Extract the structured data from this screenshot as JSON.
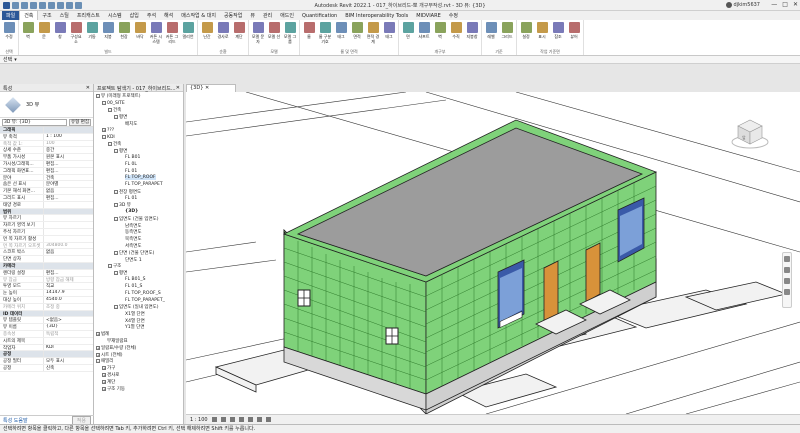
{
  "title": "Autodesk Revit 2022.1 - 017_하이브리드-뽀 개구부작성.rvt - 3D 뷰: {3D}",
  "user": "djkim5637",
  "ribbon_tabs": [
    "파일",
    "건축",
    "구조",
    "스틸",
    "프리캐스트",
    "시스템",
    "삽입",
    "주석",
    "해석",
    "매스작업 & 대지",
    "공동작업",
    "뷰",
    "관리",
    "애드인",
    "Quantification",
    "BIM Interoperability Tools",
    "MIDVIARE",
    "수정"
  ],
  "ribbon_groups": [
    {
      "label": "선택",
      "buttons": [
        "수정"
      ]
    },
    {
      "label": "빌드",
      "buttons": [
        "벽",
        "문",
        "창",
        "구성요소",
        "기둥",
        "지붕",
        "천장",
        "바닥",
        "커튼 시스템",
        "커튼 그리드",
        "멀리언"
      ]
    },
    {
      "label": "순환",
      "buttons": [
        "난간",
        "경사로",
        "계단"
      ]
    },
    {
      "label": "모델",
      "buttons": [
        "모델 문자",
        "모델 선",
        "모델 그룹"
      ]
    },
    {
      "label": "룸 및 면적",
      "buttons": [
        "룸",
        "룸 구분 기호",
        "태그",
        "면적",
        "면적 경계",
        "태그"
      ]
    },
    {
      "label": "개구부",
      "buttons": [
        "면",
        "샤프트",
        "벽",
        "수직",
        "지붕창"
      ]
    },
    {
      "label": "기준",
      "buttons": [
        "레벨",
        "그리드"
      ]
    },
    {
      "label": "작업 기준면",
      "buttons": [
        "설정",
        "표시",
        "참조",
        "뷰어"
      ]
    }
  ],
  "options_bar": {
    "select_label": "선택",
    "build_label": "빌드"
  },
  "properties": {
    "header": "특성",
    "type_name": "3D 뷰",
    "selector": "3D 뷰: {3D}",
    "edit_type": "유형 편집",
    "rows": [
      {
        "k": "그래픽",
        "v": "",
        "grp": true
      },
      {
        "k": "뷰 축척",
        "v": "1 : 100"
      },
      {
        "k": "축척 값 1:",
        "v": "100",
        "dim": true
      },
      {
        "k": "상세 수준",
        "v": "중간"
      },
      {
        "k": "부품 가시성",
        "v": "원본 표시"
      },
      {
        "k": "가시성/그래픽...",
        "v": "편집..."
      },
      {
        "k": "그래픽 화면표...",
        "v": "편집..."
      },
      {
        "k": "분야",
        "v": "건축"
      },
      {
        "k": "숨은 선 표시",
        "v": "분야별"
      },
      {
        "k": "기본 해석 화면...",
        "v": "없음"
      },
      {
        "k": "그리드 표시",
        "v": "편집..."
      },
      {
        "k": "태양 경로",
        "v": ""
      },
      {
        "k": "범위",
        "v": "",
        "grp": true
      },
      {
        "k": "뷰 자르기",
        "v": ""
      },
      {
        "k": "자르기 영역 보기",
        "v": ""
      },
      {
        "k": "주석 자르기",
        "v": ""
      },
      {
        "k": "먼 쪽 자르기 활성",
        "v": ""
      },
      {
        "k": "먼 쪽 자르기 오프셋",
        "v": "304800.0",
        "dim": true
      },
      {
        "k": "스코프 박스",
        "v": "없음"
      },
      {
        "k": "단면 상자",
        "v": ""
      },
      {
        "k": "카메라",
        "v": "",
        "grp": true
      },
      {
        "k": "렌더링 설정",
        "v": "편집..."
      },
      {
        "k": "뷰 잠금",
        "v": "방향 잠금 해제",
        "dim": true
      },
      {
        "k": "투영 모드",
        "v": "직교"
      },
      {
        "k": "눈 높이",
        "v": "14147.9"
      },
      {
        "k": "대상 높이",
        "v": "4540.0"
      },
      {
        "k": "카메라 위치",
        "v": "조정 중",
        "dim": true
      },
      {
        "k": "ID 데이터",
        "v": "",
        "grp": true
      },
      {
        "k": "뷰 템플릿",
        "v": "<없음>"
      },
      {
        "k": "뷰 이름",
        "v": "{3D}"
      },
      {
        "k": "종속성",
        "v": "독립적",
        "dim": true
      },
      {
        "k": "시트의 제목",
        "v": ""
      },
      {
        "k": "작업자",
        "v": "KDI"
      },
      {
        "k": "공정",
        "v": "",
        "grp": true
      },
      {
        "k": "공정 필터",
        "v": "모두 표시"
      },
      {
        "k": "공정",
        "v": "신축"
      }
    ],
    "help_link": "특성 도움말",
    "apply": "적용"
  },
  "browser": {
    "header": "프로젝트 탐색기 - 017_하이브리드...",
    "items": [
      {
        "t": "뷰 (미래형 프로젝트)",
        "d": 0,
        "tg": "-"
      },
      {
        "t": "00_SITE",
        "d": 1,
        "tg": "-"
      },
      {
        "t": "건축",
        "d": 2,
        "tg": "-"
      },
      {
        "t": "평면",
        "d": 3,
        "tg": "-"
      },
      {
        "t": "배치도",
        "d": 4
      },
      {
        "t": "???",
        "d": 1,
        "tg": "+"
      },
      {
        "t": "KDI",
        "d": 1,
        "tg": "-"
      },
      {
        "t": "건축",
        "d": 2,
        "tg": "-"
      },
      {
        "t": "평면",
        "d": 3,
        "tg": "-"
      },
      {
        "t": "FL B01",
        "d": 4
      },
      {
        "t": "FL 0L",
        "d": 4
      },
      {
        "t": "FL 01",
        "d": 4
      },
      {
        "t": "FL TOP_ROOF",
        "d": 4,
        "sel": true
      },
      {
        "t": "FL TOP_PARAPET",
        "d": 4
      },
      {
        "t": "천장 평면도",
        "d": 3,
        "tg": "-"
      },
      {
        "t": "FL 01",
        "d": 4
      },
      {
        "t": "3D 뷰",
        "d": 3,
        "tg": "-"
      },
      {
        "t": "{3D}",
        "d": 4,
        "b": true
      },
      {
        "t": "입면도 (건물 입면도)",
        "d": 3,
        "tg": "-"
      },
      {
        "t": "남측면도",
        "d": 4
      },
      {
        "t": "동측면도",
        "d": 4
      },
      {
        "t": "북측면도",
        "d": 4
      },
      {
        "t": "서측면도",
        "d": 4
      },
      {
        "t": "단면 (건물 단면도)",
        "d": 3,
        "tg": "-"
      },
      {
        "t": "단면도 1",
        "d": 4
      },
      {
        "t": "구조",
        "d": 2,
        "tg": "-"
      },
      {
        "t": "평면",
        "d": 3,
        "tg": "-"
      },
      {
        "t": "FL B01_S",
        "d": 4
      },
      {
        "t": "FL 01_S",
        "d": 4
      },
      {
        "t": "FL TOP_ROOF_S",
        "d": 4
      },
      {
        "t": "FL TOP_PARAPET_",
        "d": 4
      },
      {
        "t": "입면도 (일내 입면도)",
        "d": 3,
        "tg": "-"
      },
      {
        "t": "X1열 단면",
        "d": 4
      },
      {
        "t": "X4열 단면",
        "d": 4
      },
      {
        "t": "Y1열 단면",
        "d": 4
      },
      {
        "t": "범례",
        "d": 0,
        "tg": "+"
      },
      {
        "t": "부재일람표",
        "d": 1
      },
      {
        "t": "일람표/수량 (전체)",
        "d": 0,
        "tg": "+"
      },
      {
        "t": "시트 (전체)",
        "d": 0,
        "tg": "+"
      },
      {
        "t": "패밀리",
        "d": 0,
        "tg": "-"
      },
      {
        "t": "가구",
        "d": 1,
        "tg": "+"
      },
      {
        "t": "경사로",
        "d": 1,
        "tg": "+"
      },
      {
        "t": "계단",
        "d": 1,
        "tg": "+"
      },
      {
        "t": "구조 기둥",
        "d": 1,
        "tg": "+"
      }
    ]
  },
  "view_tab": "{3D}",
  "view_status": {
    "scale": "1 : 100"
  },
  "viewcube_label": "앞",
  "status_text": "선택하려면 항목을 클릭하고, 다른 항목을 선택하려면 Tab 키, 추가하려면 Ctrl 키, 선택 해제하려면 Shift 키를 누릅니다.",
  "colors": {
    "wall": "#7fd27a",
    "wall_dark": "#4fa54c",
    "roof": "#9c9c9c",
    "door": "#d8923a",
    "window": "#3a5aa8",
    "accent": "#2b5797"
  }
}
